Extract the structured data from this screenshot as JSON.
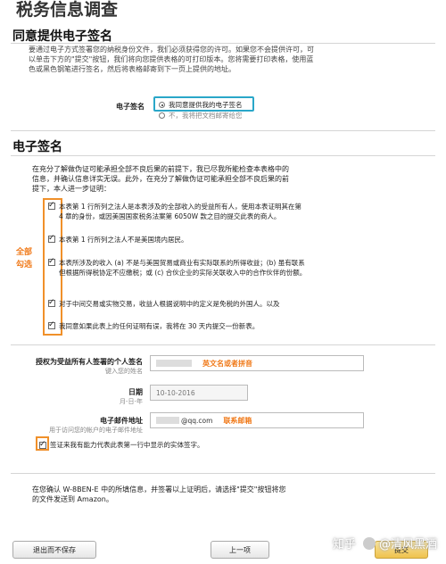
{
  "page": {
    "title": "税务信息调查"
  },
  "consent": {
    "section_title": "同意提供电子签名",
    "intro": "要通过电子方式签署您的纳税身份文件，我们必须获得您的许可。如果您不会提供许可，可以单击下方的\"提交\"按钮，我们将向您提供表格的可打印版本。您将需要打印表格，使用蓝色或黑色钢笔进行签名，然后将表格邮寄到下一页上提供的地址。",
    "label": "电子签名",
    "option_yes": "我同意提供我的电子签名",
    "option_no": "不，我将把文档邮寄给您"
  },
  "esign": {
    "section_title": "电子签名",
    "intro": "在充分了解做伪证可能承担全部不良后果的前提下，我已尽我所能检查本表格中的信息，并确认信息详实无误。此外，在充分了解做伪证可能承担全部不良后果的前提下，本人进一步证明：",
    "items": [
      {
        "text": "本表第 1 行所列之法人是本表涉及的全部收入的受益所有人，使用本表证明其在第 4 章的身份，或因美国国家税务法案第 6050W 款之目的提交此表的商人。"
      },
      {
        "text": "本表第 1 行所列之法人不是美国境内居民。"
      },
      {
        "text": "本表所涉及的收入 (a) 不是与美国贸易或商业有实际联系的所得收益；(b) 虽有联系但根据所得税协定不应缴税；或 (c) 合伙企业的实际关联收入中的合作伙伴的份额。"
      },
      {
        "text": "对于中间交易或实物交易，收益人根据说明中的定义是免税的外国人。以及"
      },
      {
        "text": "我同意如果此表上的任何证明有误，我将在 30 天内提交一份新表。"
      }
    ],
    "annotation": "全部\n勾选"
  },
  "fields": {
    "signer": {
      "label": "授权为受益所有人签署的个人签名",
      "sub": "键入您的姓名",
      "hint": "英文名或者拼音"
    },
    "date": {
      "label": "日期",
      "sub": "月-日-年",
      "value": "10-10-2016"
    },
    "email": {
      "label": "电子邮件地址",
      "sub": "用于访问您的帐户的电子邮件地址",
      "value": "@qq.com",
      "hint": "联系邮箱"
    }
  },
  "signature_confirm": {
    "text": "签证来我有能力代表此表第一行中显示的实体签字。"
  },
  "footer": {
    "text": "在您确认 W-8BEN-E 中的所填信息，并签署以上证明后，请选择\"提交\"按钮将您的文件发送到 Amazon。",
    "save_exit": "退出而不保存",
    "prev": "上一项",
    "submit": "提交"
  },
  "watermark": {
    "brand": "知乎",
    "author": "@清风黑酒"
  },
  "colors": {
    "annotation": "#f07a1a",
    "highlight": "#2aa7c9"
  }
}
